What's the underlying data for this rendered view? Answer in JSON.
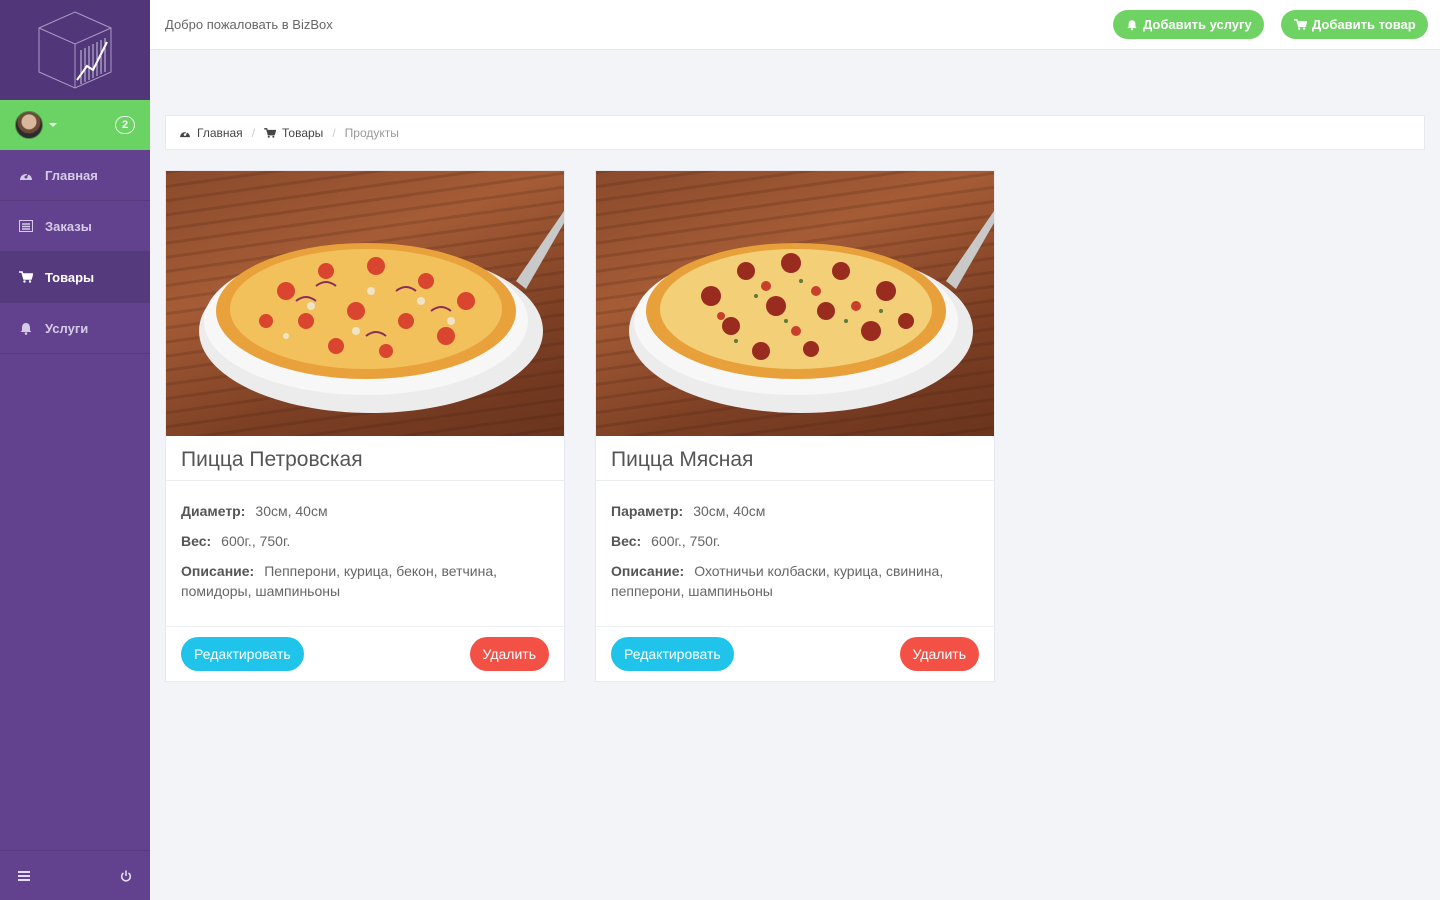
{
  "header": {
    "welcome": "Добро пожаловать в BizBox",
    "add_service": "Добавить услугу",
    "add_product": "Добавить товар"
  },
  "sidebar": {
    "badge": "2",
    "items": [
      {
        "label": "Главная",
        "icon": "dashboard-icon"
      },
      {
        "label": "Заказы",
        "icon": "list-icon"
      },
      {
        "label": "Товары",
        "icon": "cart-icon"
      },
      {
        "label": "Услуги",
        "icon": "bell-icon"
      }
    ]
  },
  "breadcrumb": {
    "home": "Главная",
    "products": "Товары",
    "current": "Продукты"
  },
  "cards": [
    {
      "title": "Пицца Петровская",
      "param1_label": "Диаметр:",
      "param1_value": "30см, 40см",
      "weight_label": "Вес:",
      "weight_value": "600г., 750г.",
      "desc_label": "Описание:",
      "desc_value": "Пепперони, курица, бекон, ветчина, помидоры, шампиньоны",
      "edit": "Редактировать",
      "delete": "Удалить"
    },
    {
      "title": "Пицца Мясная",
      "param1_label": "Параметр:",
      "param1_value": "30см, 40см",
      "weight_label": "Вес:",
      "weight_value": "600г., 750г.",
      "desc_label": "Описание:",
      "desc_value": "Охотничьи колбаски, курица, свинина, пепперони, шампиньоны",
      "edit": "Редактировать",
      "delete": "Удалить"
    }
  ],
  "colors": {
    "sidebar": "#62418f",
    "accent_green": "#6ed363",
    "edit": "#20c4ea",
    "delete": "#f35046"
  }
}
